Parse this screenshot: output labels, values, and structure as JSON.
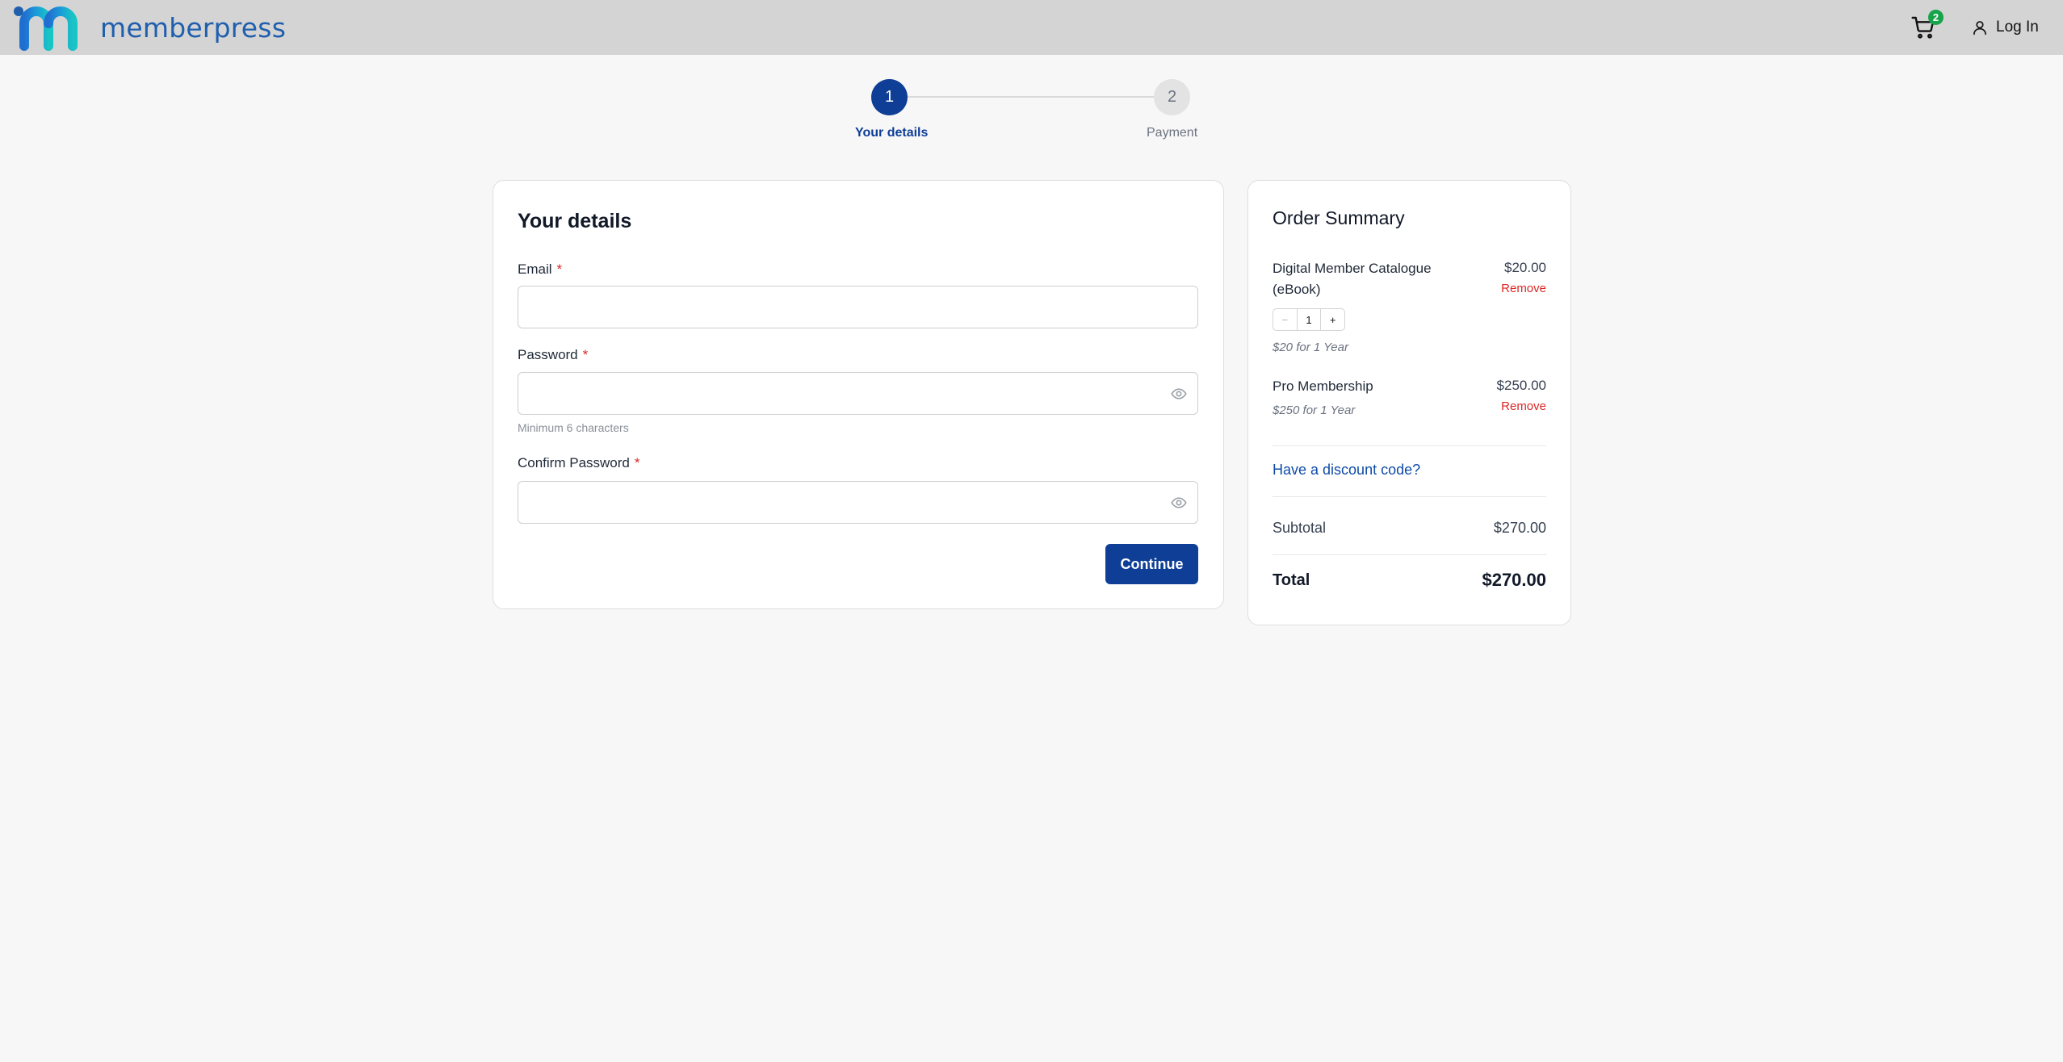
{
  "header": {
    "brand": "memberpress",
    "cart_count": "2",
    "login_label": "Log In"
  },
  "stepper": {
    "steps": [
      {
        "number": "1",
        "label": "Your details",
        "state": "active"
      },
      {
        "number": "2",
        "label": "Payment",
        "state": "inactive"
      }
    ]
  },
  "details": {
    "title": "Your details",
    "email": {
      "label": "Email",
      "required": "*",
      "value": "",
      "placeholder": ""
    },
    "password": {
      "label": "Password",
      "required": "*",
      "value": "",
      "placeholder": "",
      "helper": "Minimum 6 characters"
    },
    "confirm_password": {
      "label": "Confirm Password",
      "required": "*",
      "value": "",
      "placeholder": ""
    },
    "continue_label": "Continue"
  },
  "summary": {
    "title": "Order Summary",
    "items": [
      {
        "name": "Digital Member Catalogue (eBook)",
        "price": "$20.00",
        "remove_label": "Remove",
        "quantity": {
          "minus": "−",
          "value": "1",
          "plus": "+"
        },
        "term": "$20 for 1 Year"
      },
      {
        "name": "Pro Membership",
        "price": "$250.00",
        "remove_label": "Remove",
        "term": "$250 for 1 Year"
      }
    ],
    "discount_link": "Have a discount code?",
    "subtotal_label": "Subtotal",
    "subtotal_value": "$270.00",
    "total_label": "Total",
    "total_value": "$270.00"
  },
  "colors": {
    "primary": "#0f3e96",
    "header_bg": "#d4d4d4",
    "page_bg": "#f7f7f7",
    "danger": "#dc2626",
    "badge": "#16a34a",
    "link": "#0f4ba8"
  },
  "icons": {
    "cart": "shopping-cart-icon",
    "user": "user-icon",
    "eye": "eye-icon"
  }
}
